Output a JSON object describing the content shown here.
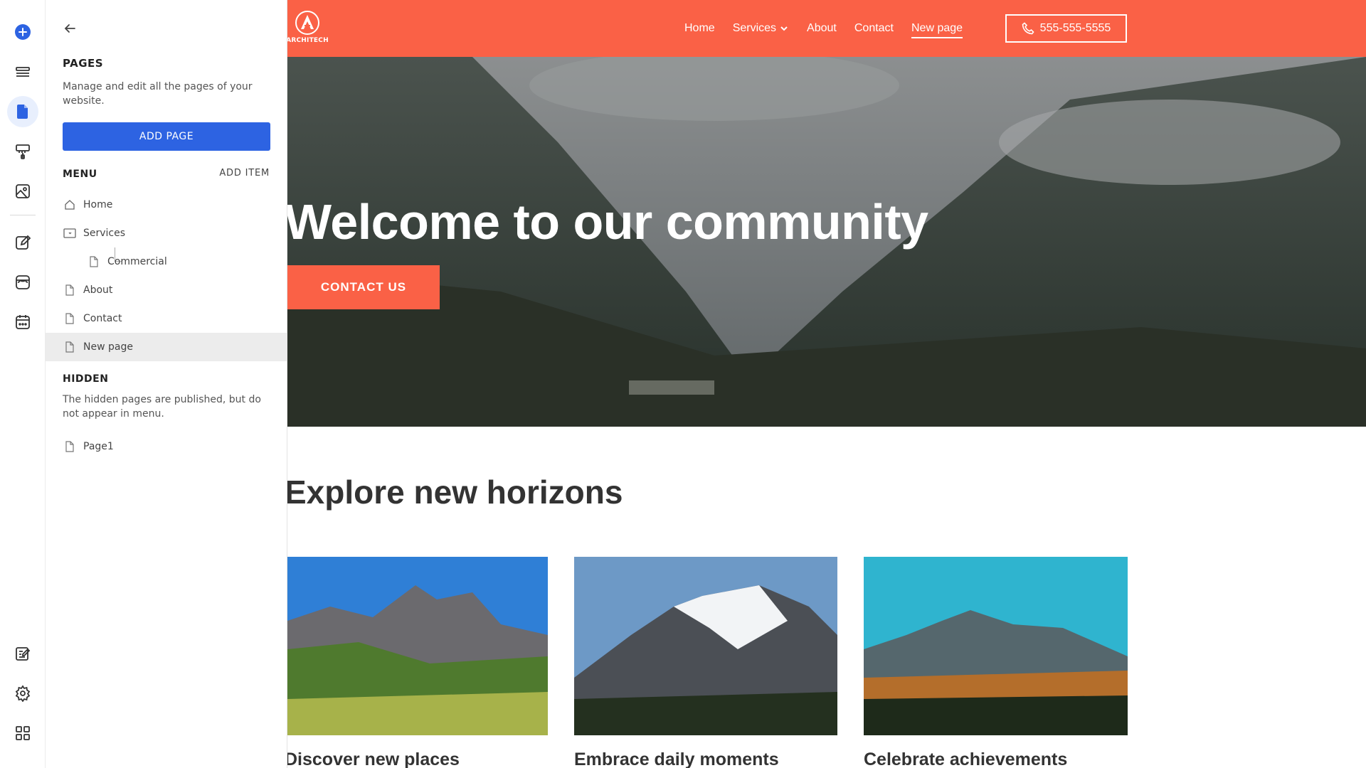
{
  "panel": {
    "title": "PAGES",
    "description": "Manage and edit all the pages of your website.",
    "add_page_label": "ADD PAGE",
    "menu_heading": "MENU",
    "add_item_label": "ADD ITEM",
    "menu_items": [
      {
        "label": "Home",
        "icon": "home-icon"
      },
      {
        "label": "Services",
        "icon": "folder-icon"
      },
      {
        "label": "Commercial",
        "icon": "page-icon"
      },
      {
        "label": "About",
        "icon": "page-icon"
      },
      {
        "label": "Contact",
        "icon": "page-icon"
      },
      {
        "label": "New page",
        "icon": "page-icon",
        "selected": true
      }
    ],
    "hidden_heading": "HIDDEN",
    "hidden_description": "The hidden pages are published, but do not appear in menu.",
    "hidden_items": [
      {
        "label": "Page1",
        "icon": "page-icon"
      }
    ]
  },
  "rail": {
    "icons": [
      "add-icon",
      "layers-icon",
      "pages-icon",
      "paint-roller-icon",
      "image-icon",
      "edit-icon",
      "store-icon",
      "calendar-icon",
      "blog-edit-icon",
      "settings-icon",
      "dashboard-icon"
    ],
    "active": "pages-icon",
    "accent": "#2d63e2"
  },
  "site": {
    "brand_color": "#fa6146",
    "logo_text": "ARCHITECH",
    "nav": [
      "Home",
      "Services",
      "About",
      "Contact",
      "New page"
    ],
    "nav_current": "New page",
    "phone": "555-555-5555",
    "hero_title": "Welcome to our community",
    "hero_cta": "CONTACT US",
    "section_title": "Explore new horizons",
    "cards": [
      {
        "title": "Discover new places"
      },
      {
        "title": "Embrace daily moments"
      },
      {
        "title": "Celebrate achievements"
      }
    ]
  }
}
